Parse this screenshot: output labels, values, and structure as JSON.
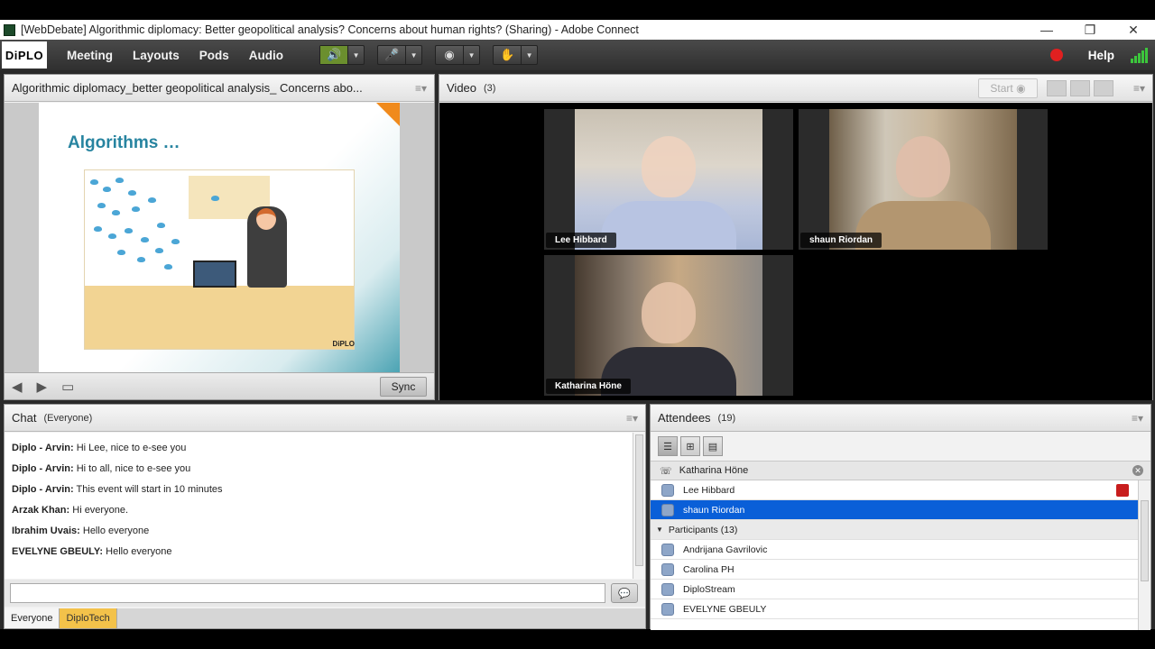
{
  "window": {
    "title": "[WebDebate] Algorithmic diplomacy: Better geopolitical analysis? Concerns about human rights? (Sharing) - Adobe Connect",
    "minimize": "—",
    "restore": "❐",
    "close": "✕"
  },
  "menubar": {
    "logo": "DiPLO",
    "items": [
      "Meeting",
      "Layouts",
      "Pods",
      "Audio"
    ],
    "help": "Help"
  },
  "share_pod": {
    "title": "Algorithmic diplomacy_better geopolitical analysis_ Concerns abo...",
    "slide_title": "Algorithms …",
    "slide_logo": "DiPLO",
    "sync_label": "Sync"
  },
  "video_pod": {
    "title": "Video",
    "count": "(3)",
    "start_label": "Start",
    "tiles": [
      {
        "name": "Lee Hibbard"
      },
      {
        "name": "shaun Riordan"
      },
      {
        "name": "Katharina Höne"
      }
    ]
  },
  "chat_pod": {
    "title": "Chat",
    "scope": "(Everyone)",
    "messages": [
      {
        "sender": "Diplo - Arvin:",
        "text": "Hi Lee, nice to e-see you"
      },
      {
        "sender": "Diplo - Arvin:",
        "text": "Hi to all, nice to e-see you"
      },
      {
        "sender": "Diplo - Arvin:",
        "text": "This event will start in 10 minutes"
      },
      {
        "sender": "Arzak Khan:",
        "text": "Hi everyone."
      },
      {
        "sender": "Ibrahim Uvais:",
        "text": "Hello everyone"
      },
      {
        "sender": "EVELYNE GBEULY:",
        "text": "Hello everyone"
      }
    ],
    "input_value": "",
    "tabs": [
      "Everyone",
      "DiploTech"
    ]
  },
  "attendees_pod": {
    "title": "Attendees",
    "count": "(19)",
    "speaking": "Katharina Höne",
    "rows": [
      {
        "name": "Lee Hibbard"
      },
      {
        "name": "shaun Riordan"
      }
    ],
    "participants_group": "Participants (13)",
    "participants": [
      {
        "name": "Andrijana Gavrilovic"
      },
      {
        "name": "Carolina PH"
      },
      {
        "name": "DiploStream"
      },
      {
        "name": "EVELYNE GBEULY"
      }
    ]
  },
  "colors": {
    "accent_selection": "#0a5fd8",
    "recording": "#e02020",
    "audio_active": "#6b8f2e",
    "chat_tab_highlight": "#f3c24a",
    "slide_title": "#2784a0"
  }
}
